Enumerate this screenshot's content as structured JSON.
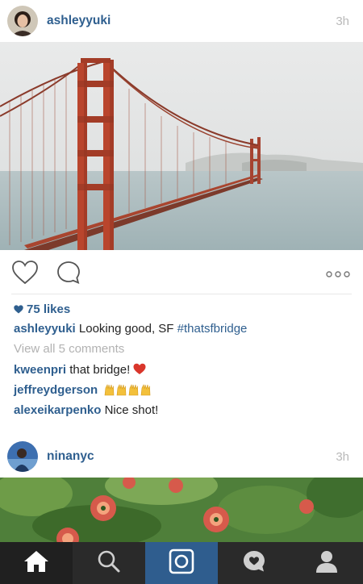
{
  "posts": [
    {
      "username": "ashleyyuki",
      "time": "3h",
      "likes": "75 likes",
      "caption_user": "ashleyyuki",
      "caption_text": "Looking good, SF",
      "caption_hashtag": "#thatsfbridge",
      "view_comments": "View all 5 comments",
      "comments": [
        {
          "user": "kweenpri",
          "text": "that bridge!",
          "emoji": "heart"
        },
        {
          "user": "jeffreydgerson",
          "text": "",
          "emoji": "raised-hands x4"
        },
        {
          "user": "alexeikarpenko",
          "text": "Nice shot!",
          "emoji": ""
        }
      ]
    },
    {
      "username": "ninanyc",
      "time": "3h"
    }
  ],
  "icons": {
    "like": "heart-outline-icon",
    "comment": "speech-bubble-icon",
    "more": "three-dots-icon",
    "likes_indicator": "heart-filled-icon"
  },
  "tabs": [
    {
      "name": "home",
      "icon": "home-icon"
    },
    {
      "name": "explore",
      "icon": "search-icon"
    },
    {
      "name": "camera",
      "icon": "camera-icon",
      "active": true
    },
    {
      "name": "activity",
      "icon": "heart-bubble-icon"
    },
    {
      "name": "profile",
      "icon": "person-icon"
    }
  ],
  "colors": {
    "link_blue": "#2f5f8f",
    "muted_gray": "#b2b2b2",
    "tabbar_bg": "#2a2a2a",
    "tab_active_bg": "#2f5d8e",
    "heart_red": "#d9362b"
  }
}
